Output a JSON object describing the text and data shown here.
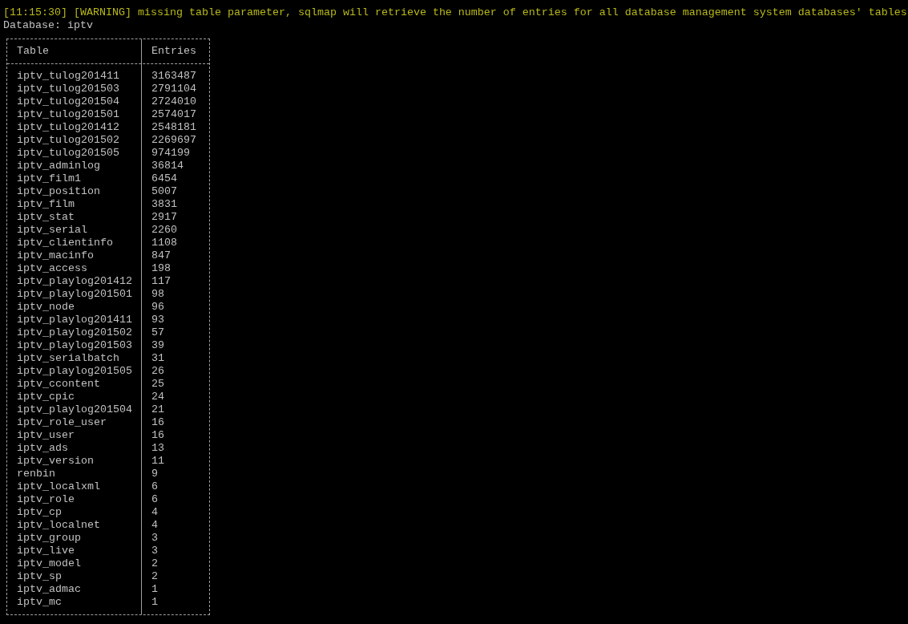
{
  "log": {
    "warning": "[11:15:30] [WARNING] missing table parameter, sqlmap will retrieve the number of entries for all database management system databases' tables",
    "database_line": "Database: iptv"
  },
  "table": {
    "columns": [
      "Table",
      "Entries"
    ],
    "rows": [
      {
        "table": "iptv_tulog201411",
        "entries": "3163487"
      },
      {
        "table": "iptv_tulog201503",
        "entries": "2791104"
      },
      {
        "table": "iptv_tulog201504",
        "entries": "2724010"
      },
      {
        "table": "iptv_tulog201501",
        "entries": "2574017"
      },
      {
        "table": "iptv_tulog201412",
        "entries": "2548181"
      },
      {
        "table": "iptv_tulog201502",
        "entries": "2269697"
      },
      {
        "table": "iptv_tulog201505",
        "entries": "974199"
      },
      {
        "table": "iptv_adminlog",
        "entries": "36814"
      },
      {
        "table": "iptv_film1",
        "entries": "6454"
      },
      {
        "table": "iptv_position",
        "entries": "5007"
      },
      {
        "table": "iptv_film",
        "entries": "3831"
      },
      {
        "table": "iptv_stat",
        "entries": "2917"
      },
      {
        "table": "iptv_serial",
        "entries": "2260"
      },
      {
        "table": "iptv_clientinfo",
        "entries": "1108"
      },
      {
        "table": "iptv_macinfo",
        "entries": "847"
      },
      {
        "table": "iptv_access",
        "entries": "198"
      },
      {
        "table": "iptv_playlog201412",
        "entries": "117"
      },
      {
        "table": "iptv_playlog201501",
        "entries": "98"
      },
      {
        "table": "iptv_node",
        "entries": "96"
      },
      {
        "table": "iptv_playlog201411",
        "entries": "93"
      },
      {
        "table": "iptv_playlog201502",
        "entries": "57"
      },
      {
        "table": "iptv_playlog201503",
        "entries": "39"
      },
      {
        "table": "iptv_serialbatch",
        "entries": "31"
      },
      {
        "table": "iptv_playlog201505",
        "entries": "26"
      },
      {
        "table": "iptv_ccontent",
        "entries": "25"
      },
      {
        "table": "iptv_cpic",
        "entries": "24"
      },
      {
        "table": "iptv_playlog201504",
        "entries": "21"
      },
      {
        "table": "iptv_role_user",
        "entries": "16"
      },
      {
        "table": "iptv_user",
        "entries": "16"
      },
      {
        "table": "iptv_ads",
        "entries": "13"
      },
      {
        "table": "iptv_version",
        "entries": "11"
      },
      {
        "table": "renbin",
        "entries": "9"
      },
      {
        "table": "iptv_localxml",
        "entries": "6"
      },
      {
        "table": "iptv_role",
        "entries": "6"
      },
      {
        "table": "iptv_cp",
        "entries": "4"
      },
      {
        "table": "iptv_localnet",
        "entries": "4"
      },
      {
        "table": "iptv_group",
        "entries": "3"
      },
      {
        "table": "iptv_live",
        "entries": "3"
      },
      {
        "table": "iptv_model",
        "entries": "2"
      },
      {
        "table": "iptv_sp",
        "entries": "2"
      },
      {
        "table": "iptv_admac",
        "entries": "1"
      },
      {
        "table": "iptv_mc",
        "entries": "1"
      }
    ]
  }
}
